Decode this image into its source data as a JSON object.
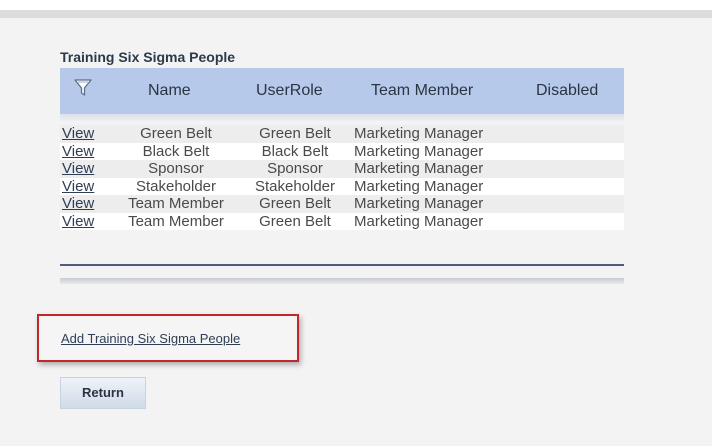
{
  "page": {
    "section_title": "Training Six Sigma People"
  },
  "grid": {
    "columns": {
      "filter_icon": "filter-icon",
      "name": "Name",
      "user_role": "UserRole",
      "team_member": "Team Member",
      "disabled": "Disabled"
    },
    "rows": [
      {
        "action": "View",
        "name": "Green Belt",
        "user_role": "Green Belt",
        "team_member": "Marketing Manager",
        "disabled": ""
      },
      {
        "action": "View",
        "name": "Black Belt",
        "user_role": "Black Belt",
        "team_member": "Marketing Manager",
        "disabled": ""
      },
      {
        "action": "View",
        "name": "Sponsor",
        "user_role": "Sponsor",
        "team_member": "Marketing Manager",
        "disabled": ""
      },
      {
        "action": "View",
        "name": "Stakeholder",
        "user_role": "Stakeholder",
        "team_member": "Marketing Manager",
        "disabled": ""
      },
      {
        "action": "View",
        "name": "Team Member",
        "user_role": "Green Belt",
        "team_member": "Marketing Manager",
        "disabled": ""
      },
      {
        "action": "View",
        "name": "Team Member",
        "user_role": "Green Belt",
        "team_member": "Marketing Manager",
        "disabled": ""
      }
    ]
  },
  "actions": {
    "add_link": "Add Training Six Sigma People",
    "return_button": "Return"
  },
  "colors": {
    "header_bg": "#b7c9ea",
    "highlight_border": "#c0262c",
    "link": "#2f3e55"
  }
}
